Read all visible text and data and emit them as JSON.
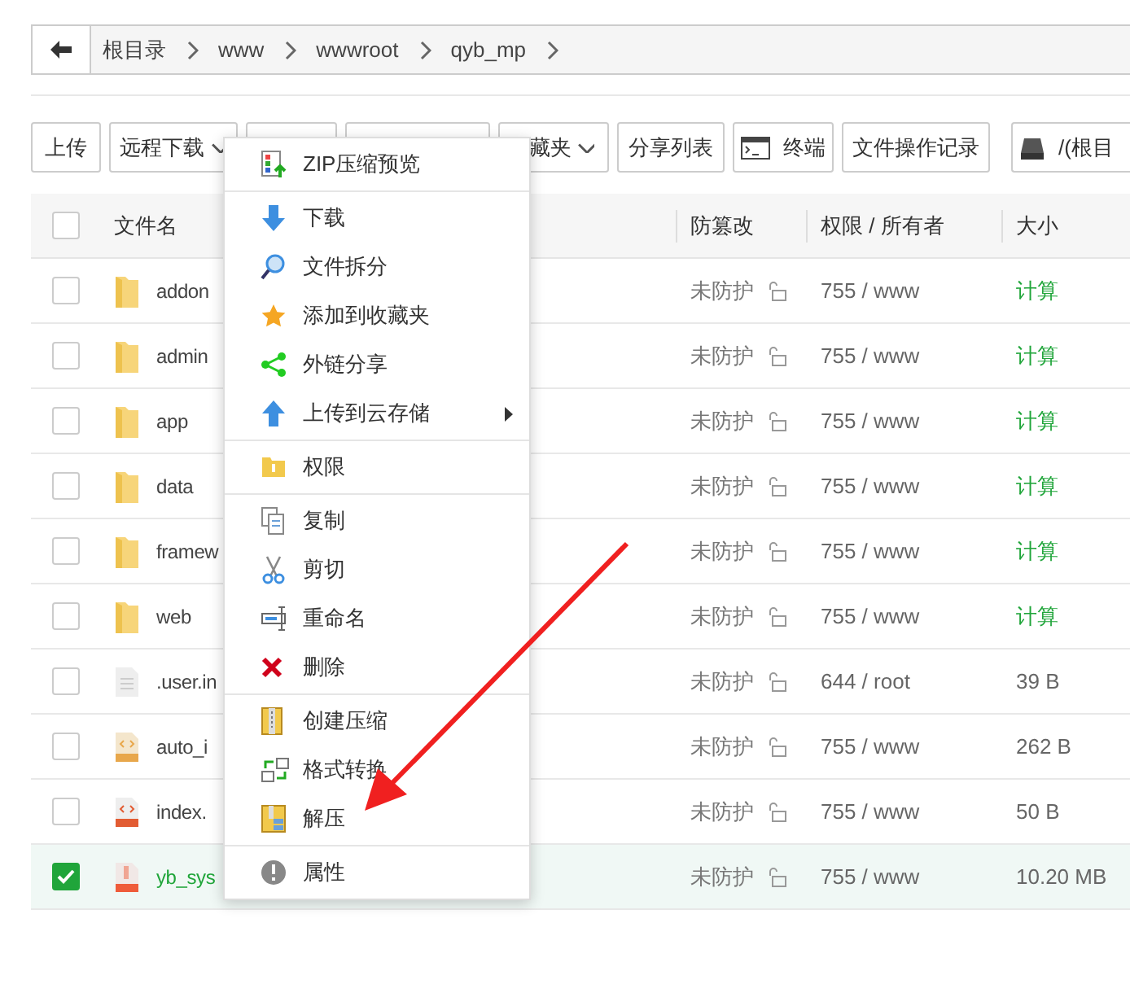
{
  "breadcrumb": {
    "items": [
      "根目录",
      "www",
      "wwwroot",
      "qyb_mp"
    ]
  },
  "toolbar": [
    {
      "kind": "plain",
      "label": "上传"
    },
    {
      "kind": "dropdown",
      "label": "远程下载"
    },
    {
      "kind": "hidden"
    },
    {
      "kind": "hidden"
    },
    {
      "kind": "dropdown",
      "label": "藏夹"
    },
    {
      "kind": "plain",
      "label": "分享列表"
    },
    {
      "kind": "terminal",
      "label": "终端"
    },
    {
      "kind": "plain",
      "label": "文件操作记录"
    },
    {
      "kind": "disk",
      "label": "/(根目"
    }
  ],
  "table": {
    "header_checked": false,
    "columns": [
      "文件名",
      "防篡改",
      "权限 / 所有者",
      "大小"
    ],
    "rows": [
      {
        "name": "addon",
        "kind": "folder",
        "protection": "未防护",
        "perm": "755 / www",
        "size": "计算",
        "size_link": true,
        "selected": false
      },
      {
        "name": "admin",
        "kind": "folder",
        "protection": "未防护",
        "perm": "755 / www",
        "size": "计算",
        "size_link": true,
        "selected": false
      },
      {
        "name": "app",
        "kind": "folder",
        "protection": "未防护",
        "perm": "755 / www",
        "size": "计算",
        "size_link": true,
        "selected": false
      },
      {
        "name": "data",
        "kind": "folder",
        "protection": "未防护",
        "perm": "755 / www",
        "size": "计算",
        "size_link": true,
        "selected": false
      },
      {
        "name": "framew",
        "kind": "folder",
        "protection": "未防护",
        "perm": "755 / www",
        "size": "计算",
        "size_link": true,
        "selected": false
      },
      {
        "name": "web",
        "kind": "folder",
        "protection": "未防护",
        "perm": "755 / www",
        "size": "计算",
        "size_link": true,
        "selected": false
      },
      {
        "name": ".user.in",
        "kind": "text",
        "protection": "未防护",
        "perm": "644 / root",
        "size": "39 B",
        "size_link": false,
        "selected": false
      },
      {
        "name": "auto_i",
        "kind": "json",
        "protection": "未防护",
        "perm": "755 / www",
        "size": "262 B",
        "size_link": false,
        "selected": false
      },
      {
        "name": "index.",
        "kind": "html",
        "protection": "未防护",
        "perm": "755 / www",
        "size": "50 B",
        "size_link": false,
        "selected": false
      },
      {
        "name": "yb_sys",
        "kind": "zip",
        "protection": "未防护",
        "perm": "755 / www",
        "size": "10.20 MB",
        "size_link": false,
        "selected": true
      }
    ]
  },
  "context_menu": {
    "groups": [
      [
        {
          "label": "ZIP压缩预览",
          "submenu": false
        }
      ],
      [
        {
          "label": "下载",
          "submenu": false
        },
        {
          "label": "文件拆分",
          "submenu": false
        },
        {
          "label": "添加到收藏夹",
          "submenu": false
        },
        {
          "label": "外链分享",
          "submenu": false
        },
        {
          "label": "上传到云存储",
          "submenu": true
        }
      ],
      [
        {
          "label": "权限",
          "submenu": false
        }
      ],
      [
        {
          "label": "复制",
          "submenu": false
        },
        {
          "label": "剪切",
          "submenu": false
        },
        {
          "label": "重命名",
          "submenu": false
        },
        {
          "label": "删除",
          "submenu": false
        }
      ],
      [
        {
          "label": "创建压缩",
          "submenu": false
        },
        {
          "label": "格式转换",
          "submenu": false
        },
        {
          "label": "解压",
          "submenu": false
        }
      ],
      [
        {
          "label": "属性",
          "submenu": false
        }
      ]
    ]
  }
}
